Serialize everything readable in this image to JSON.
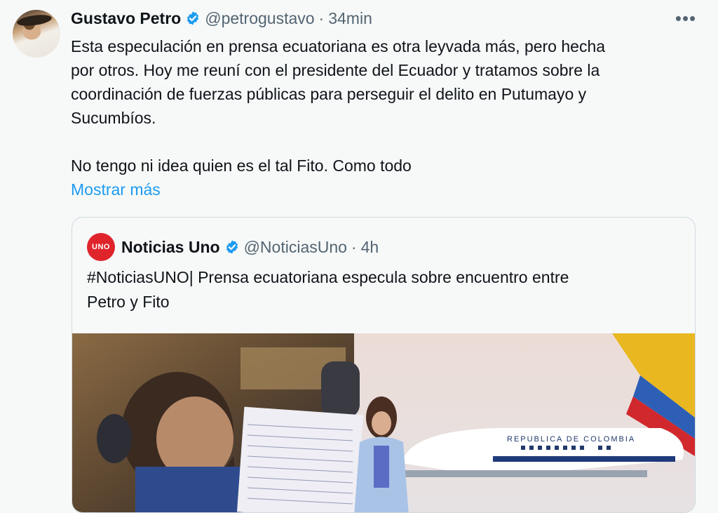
{
  "tweet": {
    "author_name": "Gustavo Petro",
    "handle": "@petrogustavo",
    "separator": "·",
    "time": "34min",
    "more_label": "•••",
    "text": "Esta especulación en prensa ecuatoriana es otra leyvada más, pero hecha\npor otros. Hoy me reuní con el presidente del Ecuador y tratamos sobre la\ncoordinación de fuerzas públicas para perseguir el delito en Putumayo y\nSucumbíos.\n\nNo tengo ni idea quien es el tal Fito. Como todo",
    "show_more": "Mostrar más"
  },
  "quote": {
    "avatar_text": "UNO",
    "author_name": "Noticias Uno",
    "handle": "@NoticiasUno",
    "separator": "·",
    "time": "4h",
    "text": "#NoticiasUNO| Prensa ecuatoriana especula sobre encuentro entre\nPetro y Fito",
    "image_plane_text": "REPUBLICA DE COLOMBIA"
  },
  "colors": {
    "link": "#1d9bf0",
    "verified": "#1d9bf0",
    "muted": "#536471",
    "brand_red": "#e0242b"
  },
  "icons": [
    "verified-badge-icon",
    "more-options-icon"
  ]
}
